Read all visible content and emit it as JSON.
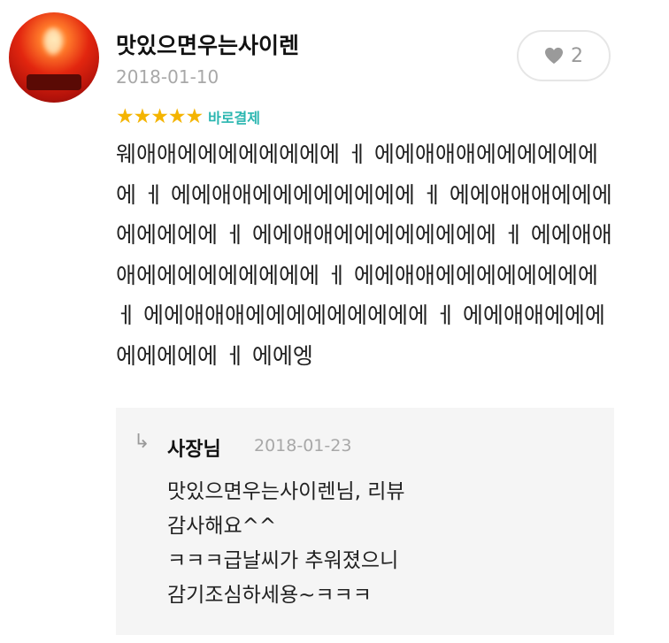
{
  "review": {
    "username": "맛있으면우는사이렌",
    "date": "2018-01-10",
    "likes": "2",
    "rating": 5,
    "stars": "★★★★★",
    "badge": "바로결제",
    "body": "웨애애에에에에에에에에 ㅔ 에에애애애에에에에에에에 ㅔ 에에애애에에에에에에에에 ㅔ 에에애애애에에에에에에에에 ㅔ 에에애애에에에에에에에에 ㅔ 에에애애애에에에에에에에에에 ㅔ 에에애애에에에에에에에에 ㅔ 에에애애애에에에에에에에에에 ㅔ 에에애애에에에에에에에에 ㅔ 에에엥"
  },
  "reply": {
    "author": "사장님",
    "date": "2018-01-23",
    "text": "맛있으면우는사이렌님, 리뷰\n감사해요^^\nㅋㅋㅋ급날씨가 추워졌으니\n감기조심하세용~ㅋㅋㅋ"
  },
  "icons": {
    "avatar": "red-siren-image",
    "like": "heart-icon",
    "reply": "reply-arrow-icon",
    "rating": "star-icon"
  },
  "colors": {
    "star": "#f4b400",
    "badge": "#2ab6b0",
    "meta": "#a8a8a8",
    "reply_bg": "#f5f5f5"
  }
}
